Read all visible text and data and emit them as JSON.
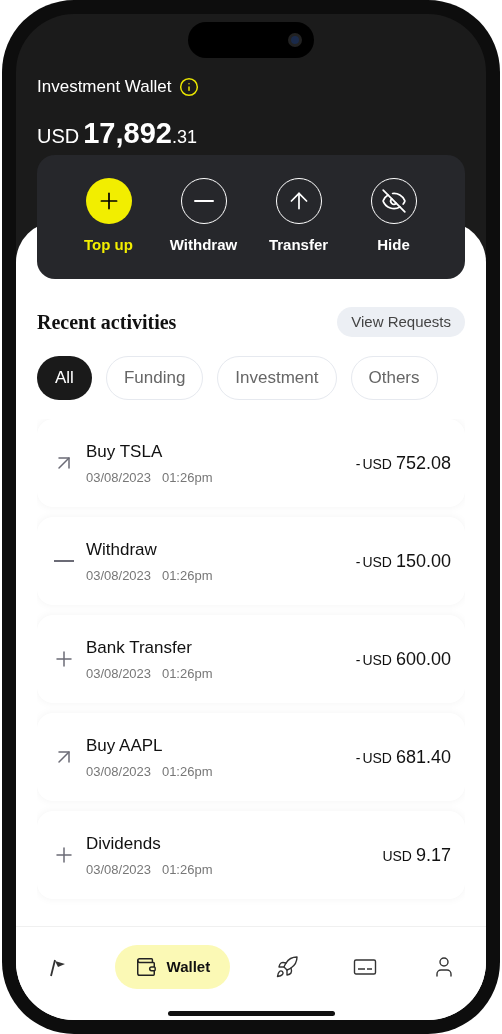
{
  "header": {
    "title": "Investment Wallet",
    "currency": "USD",
    "amount_whole": "17,892",
    "amount_cents": ".31"
  },
  "actions": [
    {
      "kind": "plus",
      "label": "Top up",
      "selected": true
    },
    {
      "kind": "minus",
      "label": "Withdraw",
      "selected": false
    },
    {
      "kind": "up",
      "label": "Transfer",
      "selected": false
    },
    {
      "kind": "hide",
      "label": "Hide",
      "selected": false
    }
  ],
  "section": {
    "title": "Recent activities",
    "button": "View Requests"
  },
  "filters": [
    {
      "label": "All",
      "selected": true
    },
    {
      "label": "Funding",
      "selected": false
    },
    {
      "label": "Investment",
      "selected": false
    },
    {
      "label": "Others",
      "selected": false
    }
  ],
  "activities": [
    {
      "kind": "buy",
      "title": "Buy TSLA",
      "date": "03/08/2023",
      "time": "01:26pm",
      "sign": "-",
      "currency": "USD",
      "amount": "752.08"
    },
    {
      "kind": "withdraw",
      "title": "Withdraw",
      "date": "03/08/2023",
      "time": "01:26pm",
      "sign": "-",
      "currency": "USD",
      "amount": "150.00"
    },
    {
      "kind": "deposit",
      "title": "Bank Transfer",
      "date": "03/08/2023",
      "time": "01:26pm",
      "sign": "-",
      "currency": "USD",
      "amount": "600.00"
    },
    {
      "kind": "buy",
      "title": "Buy AAPL",
      "date": "03/08/2023",
      "time": "01:26pm",
      "sign": "-",
      "currency": "USD",
      "amount": "681.40"
    },
    {
      "kind": "deposit",
      "title": "Dividends",
      "date": "03/08/2023",
      "time": "01:26pm",
      "currency": "USD",
      "amount": "9.17"
    }
  ],
  "nav": [
    {
      "kind": "flag",
      "selected": false
    },
    {
      "kind": "wallet",
      "label": "Wallet",
      "selected": true
    },
    {
      "kind": "rocket",
      "selected": false
    },
    {
      "kind": "card",
      "selected": false
    },
    {
      "kind": "user",
      "selected": false
    }
  ]
}
